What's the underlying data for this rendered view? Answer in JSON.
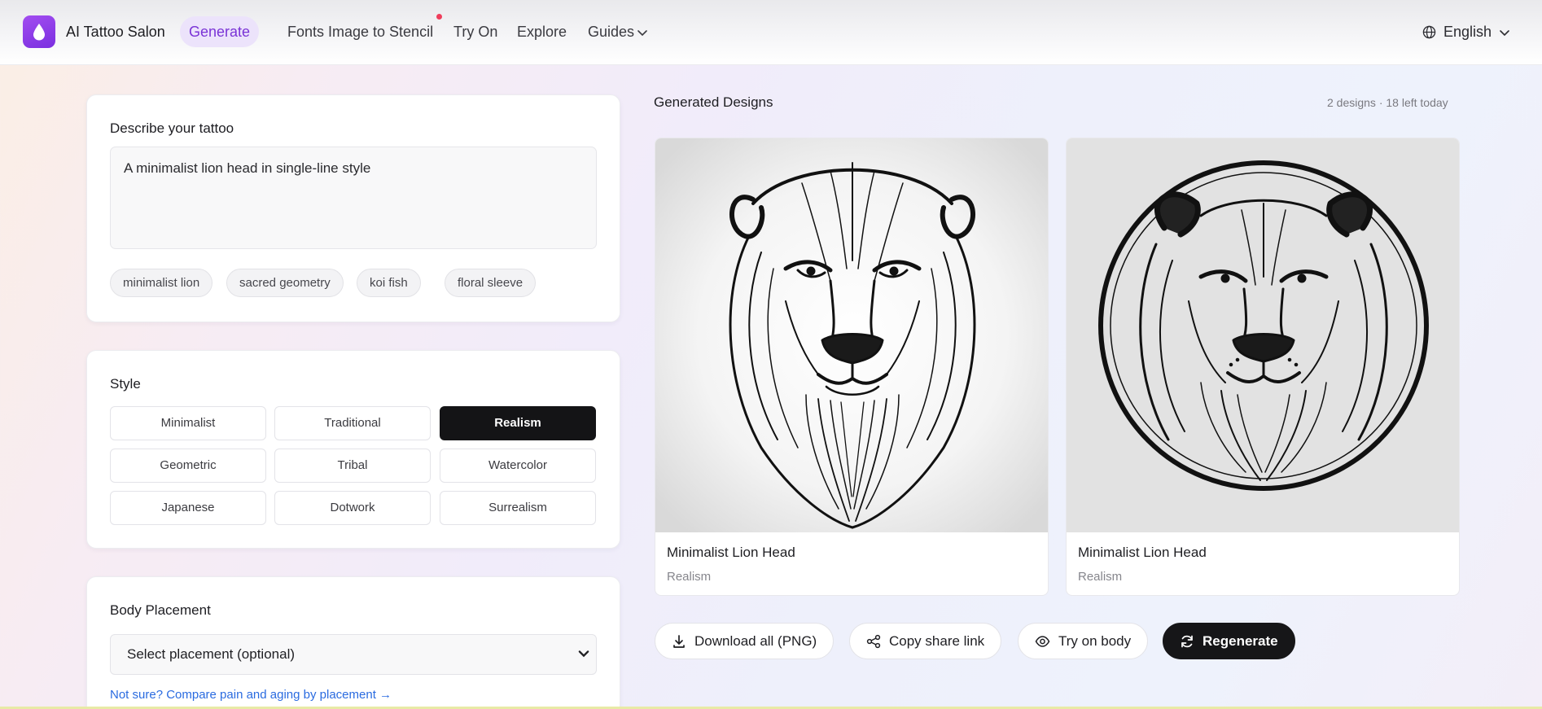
{
  "header": {
    "brand": "AI Tattoo Salon",
    "logo_icon": "droplet-icon",
    "nav": [
      {
        "label": "Generate",
        "active": true
      },
      {
        "label": "Fonts"
      },
      {
        "label": "Image to Stencil",
        "has_dot": true
      },
      {
        "label": "Try On"
      },
      {
        "label": "Explore"
      },
      {
        "label": "Guides",
        "has_dropdown": true
      }
    ],
    "language": "English"
  },
  "describe": {
    "title": "Describe your tattoo",
    "prompt_value": "A minimalist lion head in single-line style",
    "suggestions": [
      "minimalist lion",
      "sacred geometry",
      "koi fish",
      "floral sleeve"
    ]
  },
  "style": {
    "title": "Style",
    "options": [
      "Minimalist",
      "Traditional",
      "Realism",
      "Geometric",
      "Tribal",
      "Watercolor",
      "Japanese",
      "Dotwork",
      "Surrealism"
    ],
    "selected": "Realism"
  },
  "placement": {
    "title": "Body Placement",
    "select_value": "Select placement (optional)",
    "help_link": "Not sure? Compare pain and aging by placement →"
  },
  "results": {
    "title": "Generated Designs",
    "quota": "2 designs · 18 left today",
    "designs": [
      {
        "title": "Minimalist Lion Head",
        "style": "Realism"
      },
      {
        "title": "Minimalist Lion Head",
        "style": "Realism"
      }
    ],
    "actions": {
      "download": "Download all (PNG)",
      "share": "Copy share link",
      "try_on": "Try on body",
      "regenerate": "Regenerate"
    }
  },
  "colors": {
    "accent": "#7a33d6",
    "accent_bg": "#ece3fb",
    "link": "#2a6be0",
    "dark_button": "#161618",
    "notification_dot": "#ef3d5b"
  }
}
